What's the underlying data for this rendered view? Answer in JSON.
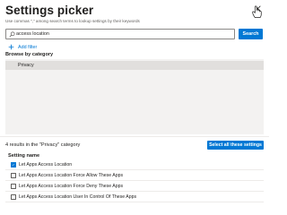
{
  "header": {
    "title": "Settings picker",
    "subtitle": "Use commas \",\" among search terms to lookup settings by their keywords"
  },
  "search": {
    "value": "access location",
    "button_label": "Search"
  },
  "filters": {
    "add_label": "Add filter"
  },
  "browse": {
    "label": "Browse by category",
    "categories": [
      {
        "label": "Privacy",
        "selected": true
      }
    ]
  },
  "results": {
    "count_text": "4 results in the \"Privacy\" category",
    "select_all_label": "Select all these settings",
    "column_header": "Setting name",
    "items": [
      {
        "label": "Let Apps Access Location",
        "checked": true
      },
      {
        "label": "Let Apps Access Location Force Allow These Apps",
        "checked": false
      },
      {
        "label": "Let Apps Access Location Force Deny These Apps",
        "checked": false
      },
      {
        "label": "Let Apps Access Location User In Control Of These Apps",
        "checked": false
      }
    ]
  },
  "colors": {
    "accent": "#0078d4",
    "panel_bg": "#f3f2f1",
    "selected_row_bg": "#e1dfdd"
  },
  "icons": [
    "close-icon",
    "cursor-icon",
    "search-icon",
    "plus-icon",
    "check-icon"
  ]
}
